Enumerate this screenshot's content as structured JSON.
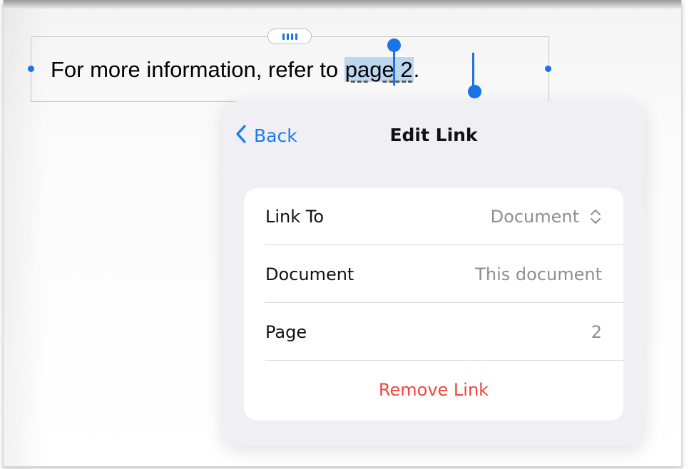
{
  "canvas": {
    "sentence_prefix": "For more information, refer to ",
    "link_text": "page 2",
    "sentence_suffix": "."
  },
  "popover": {
    "back_label": "Back",
    "title": "Edit Link",
    "rows": [
      {
        "label": "Link To",
        "value": "Document"
      },
      {
        "label": "Document",
        "value": "This document"
      },
      {
        "label": "Page",
        "value": "2"
      }
    ],
    "remove_label": "Remove Link"
  },
  "colors": {
    "accent": "#1a7cf2",
    "selection": "#bcd6ef",
    "destructive": "#f2453d",
    "secondary_text": "#8e8e93"
  },
  "icons": {
    "back": "chevron-left-icon",
    "link_to_picker": "up-down-chevron-icon",
    "drag_handle": "grip-handle-icon"
  }
}
